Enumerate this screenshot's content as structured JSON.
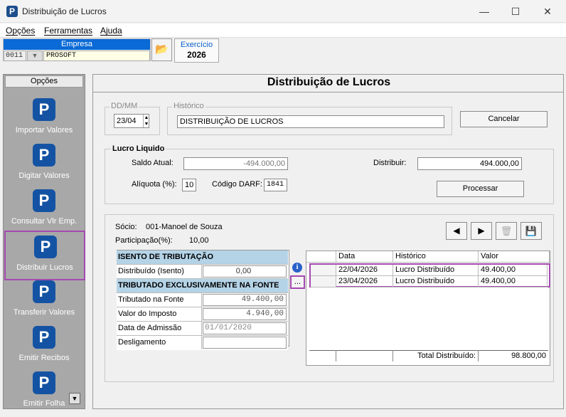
{
  "window": {
    "title": "Distribuição de Lucros",
    "icon": "P"
  },
  "menu": [
    "Opções",
    "Ferramentas",
    "Ajuda"
  ],
  "empresa": {
    "label": "Empresa",
    "code": "0011",
    "name": "PROSOFT"
  },
  "exercicio": {
    "label": "Exercício",
    "value": "2026"
  },
  "sidebar": {
    "header": "Opções",
    "items": [
      {
        "label": "Importar Valores"
      },
      {
        "label": "Digitar Valores"
      },
      {
        "label": "Consultar Vlr Emp."
      },
      {
        "label": "Distribuir Lucros"
      },
      {
        "label": "Transferir Valores"
      },
      {
        "label": "Emitir Recibos"
      },
      {
        "label": "Emitir Folha"
      }
    ]
  },
  "main": {
    "title": "Distribuição de Lucros",
    "ddmm_label": "DD/MM",
    "ddmm_value": "23/04",
    "historico_label": "Histórico",
    "historico_value": "DISTRIBUIÇÃO DE LUCROS",
    "cancel_label": "Cancelar",
    "lucro": {
      "legend": "Lucro Liquido",
      "saldo_label": "Saldo Atual:",
      "saldo_value": "-494.000,00",
      "distribuir_label": "Distribuir:",
      "distribuir_value": "494.000,00",
      "aliquota_label": "Alíquota (%):",
      "aliquota_value": "10",
      "darf_label": "Código DARF:",
      "darf_value": "1841",
      "processar_label": "Processar"
    },
    "socio": {
      "socio_label": "Sócio:",
      "socio_value": "001-Manoel de Souza",
      "part_label": "Participação(%):",
      "part_value": "10,00"
    },
    "tax": {
      "isento_header": "ISENTO DE TRIBUTAÇÃO",
      "distribuido_label": "Distribuído (Isento)",
      "distribuido_value": "0,00",
      "tributado_header": "TRIBUTADO EXCLUSIVAMENTE NA FONTE",
      "tributado_label": "Tributado na Fonte",
      "tributado_value": "49.400,00",
      "imposto_label": "Valor do Imposto",
      "imposto_value": "4.940,00",
      "admissao_label": "Data de Admissão",
      "admissao_value": "01/01/2020",
      "desligamento_label": "Desligamento",
      "desligamento_value": ""
    },
    "ellipsis": "...",
    "grid": {
      "columns": [
        "Data",
        "Histórico",
        "Valor"
      ],
      "rows": [
        {
          "data": "22/04/2026",
          "historico": "Lucro Distribuído",
          "valor": "49.400,00"
        },
        {
          "data": "23/04/2026",
          "historico": "Lucro Distribuído",
          "valor": "49.400,00"
        }
      ],
      "total_label": "Total Distribuído:",
      "total_value": "98.800,00"
    }
  }
}
